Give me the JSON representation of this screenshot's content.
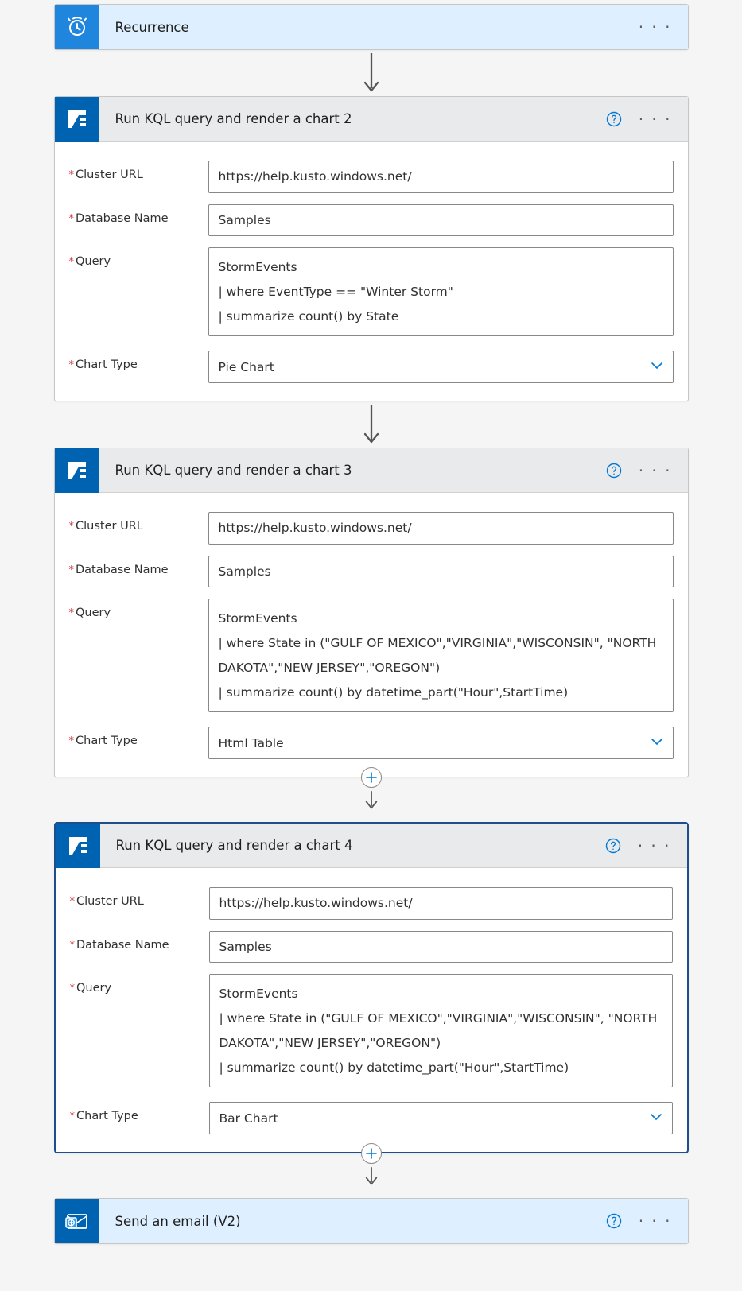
{
  "trigger": {
    "title": "Recurrence"
  },
  "actions": [
    {
      "title": "Run KQL query and render a chart 2",
      "fields": {
        "clusterUrl": {
          "label": "Cluster URL",
          "value": "https://help.kusto.windows.net/"
        },
        "databaseName": {
          "label": "Database Name",
          "value": "Samples"
        },
        "query": {
          "label": "Query",
          "value": "StormEvents\n| where EventType == \"Winter Storm\"\n| summarize count() by State",
          "rows": 3
        },
        "chartType": {
          "label": "Chart Type",
          "value": "Pie Chart"
        }
      },
      "selected": false,
      "connectorAfter": "arrow"
    },
    {
      "title": "Run KQL query and render a chart 3",
      "fields": {
        "clusterUrl": {
          "label": "Cluster URL",
          "value": "https://help.kusto.windows.net/"
        },
        "databaseName": {
          "label": "Database Name",
          "value": "Samples"
        },
        "query": {
          "label": "Query",
          "value": "StormEvents\n| where State in (\"GULF OF MEXICO\",\"VIRGINIA\",\"WISCONSIN\", \"NORTH DAKOTA\",\"NEW JERSEY\",\"OREGON\")\n| summarize count() by datetime_part(\"Hour\",StartTime)",
          "rows": 4
        },
        "chartType": {
          "label": "Chart Type",
          "value": "Html Table"
        }
      },
      "selected": false,
      "connectorAfter": "add"
    },
    {
      "title": "Run KQL query and render a chart 4",
      "fields": {
        "clusterUrl": {
          "label": "Cluster URL",
          "value": "https://help.kusto.windows.net/"
        },
        "databaseName": {
          "label": "Database Name",
          "value": "Samples"
        },
        "query": {
          "label": "Query",
          "value": "StormEvents\n| where State in (\"GULF OF MEXICO\",\"VIRGINIA\",\"WISCONSIN\", \"NORTH DAKOTA\",\"NEW JERSEY\",\"OREGON\")\n| summarize count() by datetime_part(\"Hour\",StartTime)",
          "rows": 4
        },
        "chartType": {
          "label": "Chart Type",
          "value": "Bar Chart"
        }
      },
      "selected": true,
      "connectorAfter": "add"
    }
  ],
  "finalAction": {
    "title": "Send an email (V2)"
  }
}
